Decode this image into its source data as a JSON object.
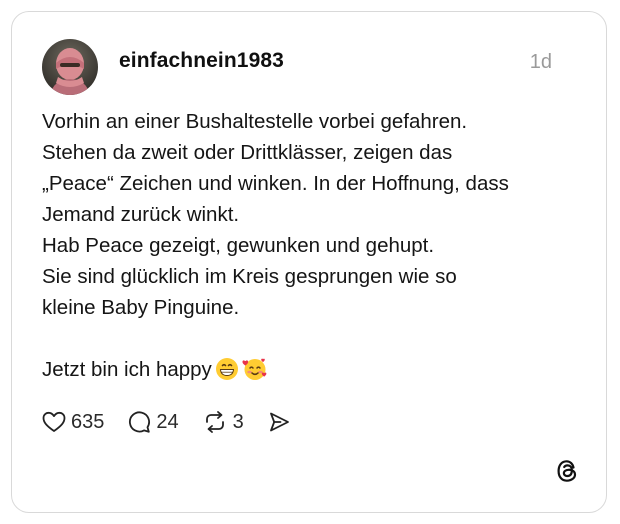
{
  "post": {
    "username": "einfachnein1983",
    "time": "1d",
    "lines": [
      "Vorhin an einer Bushaltestelle vorbei gefahren.",
      "Stehen da zweit oder Drittklässer, zeigen das",
      "„Peace“ Zeichen und winken. In der Hoffnung, dass",
      "Jemand zurück winkt.",
      "Hab Peace gezeigt, gewunken und gehupt.",
      "Sie sind glücklich im Kreis gesprungen wie so",
      "kleine Baby Pinguine.",
      "",
      "Jetzt bin ich happy"
    ],
    "emojis": [
      "grinning-face-emoji",
      "smiling-face-with-hearts-emoji"
    ]
  },
  "actions": {
    "likes": "635",
    "replies": "24",
    "reposts": "3",
    "like_icon": "heart-icon",
    "reply_icon": "speech-bubble-icon",
    "repost_icon": "repost-icon",
    "share_icon": "send-icon"
  },
  "branding": {
    "logo": "threads-logo-icon"
  },
  "colors": {
    "border": "#d9d9d9",
    "muted": "#9a9a9a",
    "text": "#101010"
  }
}
